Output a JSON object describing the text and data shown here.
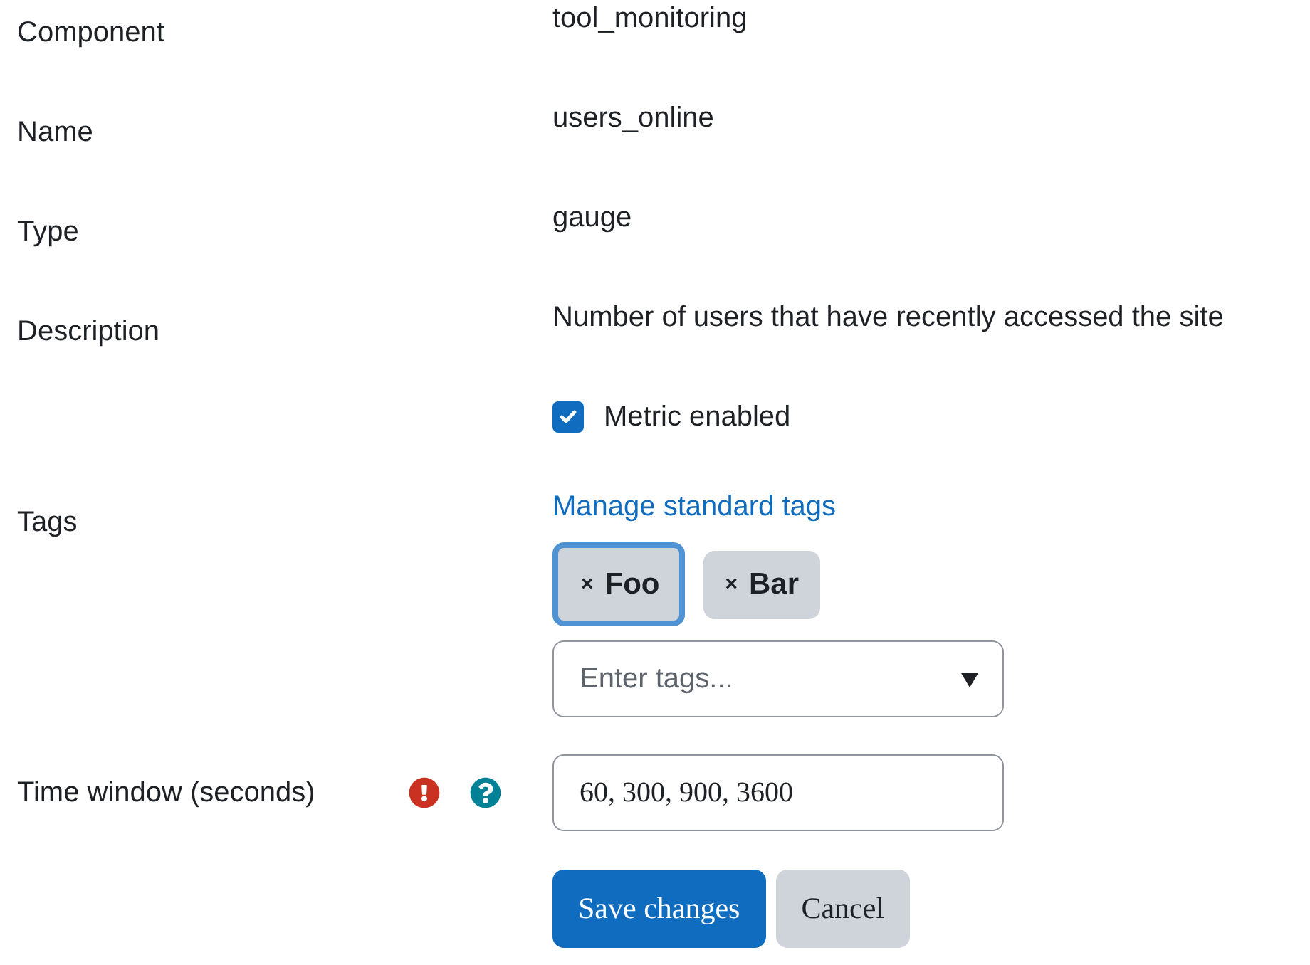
{
  "fields": [
    {
      "kind": "static",
      "label": "Component",
      "value": "tool_monitoring"
    },
    {
      "kind": "static",
      "label": "Name",
      "value": "users_online"
    },
    {
      "kind": "static",
      "label": "Type",
      "value": "gauge"
    },
    {
      "kind": "static",
      "label": "Description",
      "value": "Number of users that have recently accessed the site"
    },
    {
      "kind": "checkbox",
      "label": "Metric enabled",
      "checked": true
    },
    {
      "kind": "tags",
      "label": "Tags",
      "link": "Manage standard tags",
      "tags": [
        {
          "remove": "×",
          "label": "Foo",
          "selected": true
        },
        {
          "remove": "×",
          "label": "Bar",
          "selected": false
        }
      ],
      "placeholder": "Enter tags..."
    },
    {
      "kind": "text",
      "label": "Time window (seconds)",
      "required": true,
      "help": true,
      "value": "60, 300, 900, 3600"
    }
  ],
  "buttons": [
    {
      "label": "Save changes",
      "kind": "primary"
    },
    {
      "label": "Cancel",
      "kind": "secondary"
    }
  ]
}
